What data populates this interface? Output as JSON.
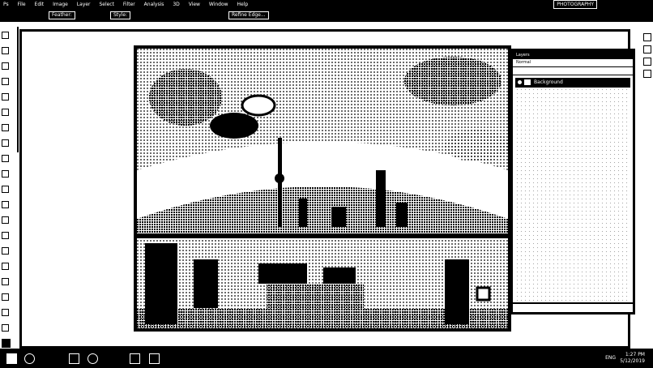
{
  "menubar": {
    "app_icon": "Ps",
    "items": [
      "File",
      "Edit",
      "Image",
      "Layer",
      "Select",
      "Filter",
      "Analysis",
      "3D",
      "View",
      "Window",
      "Help"
    ],
    "workspace": "PHOTOGRAPHY"
  },
  "options": {
    "feather_label": "Feather:",
    "style_label": "Style:",
    "refine_edge": "Refine Edge..."
  },
  "panel": {
    "tabs": "Layers",
    "blend": "Normal",
    "layer_name": "Background"
  },
  "taskbar": {
    "time": "1:27 PM",
    "date": "5/12/2019",
    "lang": "ENG"
  }
}
